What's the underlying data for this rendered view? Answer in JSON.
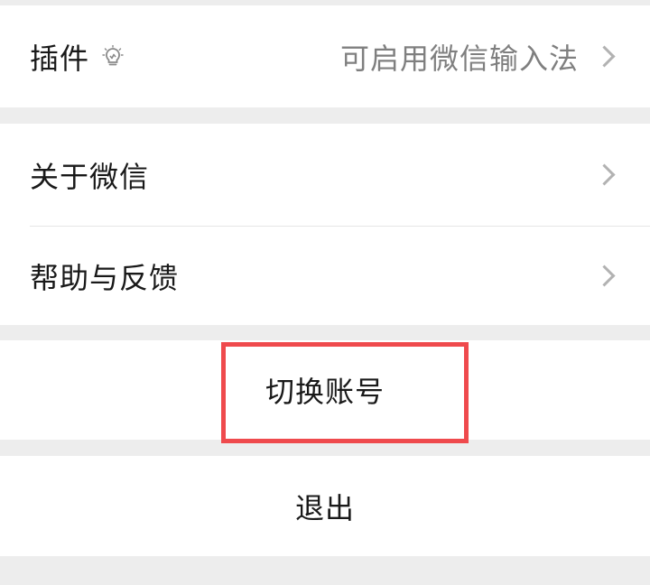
{
  "plugins": {
    "label": "插件",
    "icon": "lightbulb-icon",
    "value": "可启用微信输入法",
    "chevron": "chevron-right-icon"
  },
  "about": {
    "label": "关于微信",
    "chevron": "chevron-right-icon"
  },
  "help": {
    "label": "帮助与反馈",
    "chevron": "chevron-right-icon"
  },
  "switch_account": {
    "label": "切换账号",
    "highlight_color": "#ef4a4d"
  },
  "logout": {
    "label": "退出"
  }
}
